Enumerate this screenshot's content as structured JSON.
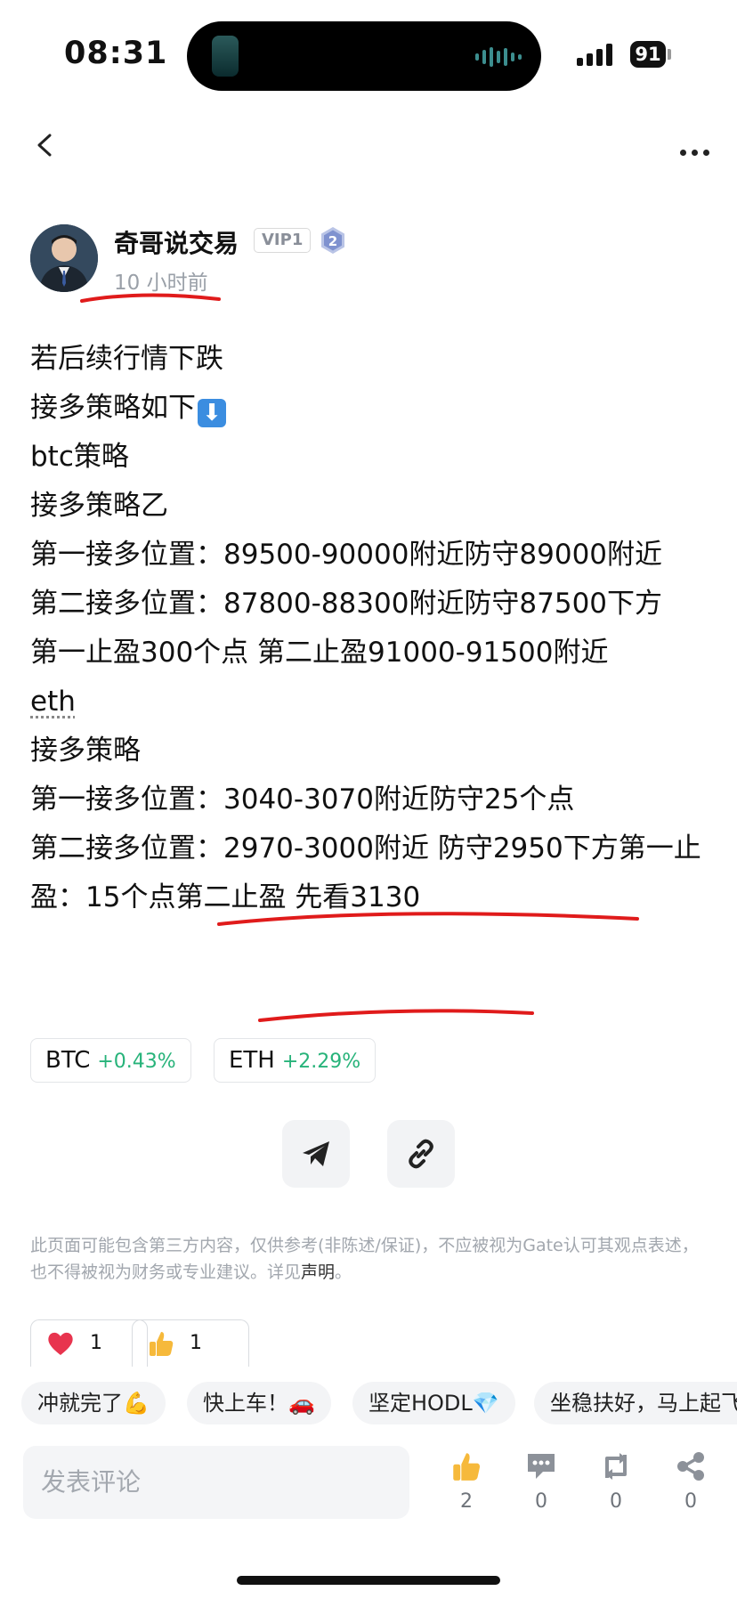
{
  "status_bar": {
    "time": "08:31",
    "battery": "91"
  },
  "author": {
    "name": "奇哥说交易",
    "vip": "VIP1",
    "level": "2",
    "time_ago": "10 小时前"
  },
  "post": {
    "lines": [
      "若后续行情下跌",
      "接多策略如下",
      "btc策略",
      "接多策略乙",
      "第一接多位置：89500-90000附近防守89000附近",
      "第二接多位置：87800-88300附近防守87500下方",
      "第一止盈300个点 第二止盈91000-91500附近",
      "eth",
      "接多策略",
      "第一接多位置：3040-3070附近防守25个点",
      "第二接多位置：2970-3000附近 防守2950下方第一止盈：15个点第二止盈 先看3130"
    ],
    "emoji_arrow": "⬇"
  },
  "tickers": [
    {
      "symbol": "BTC",
      "change": "+0.43%"
    },
    {
      "symbol": "ETH",
      "change": "+2.29%"
    }
  ],
  "disclaimer": {
    "text": "此页面可能包含第三方内容，仅供参考(非陈述/保证)，不应被视为Gate认可其观点表述，也不得被视为财务或专业建议。详见",
    "link": "声明",
    "end": "。"
  },
  "reactions": [
    {
      "icon": "heart-icon",
      "count": "1"
    },
    {
      "icon": "thumbs-up-icon",
      "count": "1"
    }
  ],
  "quick_replies": [
    "冲就完了💪",
    "快上车！🚗",
    "坚定HODL💎",
    "坐稳扶好，马上起飞"
  ],
  "bottom_bar": {
    "comment_placeholder": "发表评论",
    "like_count": "2",
    "comment_count": "0",
    "repost_count": "0",
    "share_count": "0"
  },
  "colors": {
    "positive": "#27b37a",
    "annotation": "#e01b1b",
    "heart": "#e8344e"
  }
}
